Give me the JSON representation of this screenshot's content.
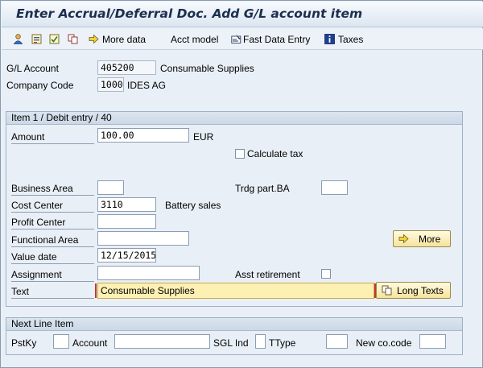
{
  "title": "Enter Accrual/Deferral Doc. Add G/L account item",
  "toolbar": {
    "more_data": "More data",
    "acct_model": "Acct model",
    "fast_data_entry": "Fast Data Entry",
    "taxes": "Taxes"
  },
  "header": {
    "gl_account_label": "G/L Account",
    "gl_account_value": "405200",
    "gl_account_desc": "Consumable Supplies",
    "company_code_label": "Company Code",
    "company_code_value": "1000",
    "company_code_desc": "IDES AG"
  },
  "item": {
    "group_title": "Item 1 / Debit entry / 40",
    "amount_label": "Amount",
    "amount_value": "100.00",
    "currency": "EUR",
    "calculate_tax_label": "Calculate tax",
    "business_area_label": "Business Area",
    "business_area_value": "",
    "trdg_part_label": "Trdg part.BA",
    "trdg_part_value": "",
    "cost_center_label": "Cost Center",
    "cost_center_value": "3110",
    "cost_center_desc": "Battery sales",
    "profit_center_label": "Profit Center",
    "profit_center_value": "",
    "functional_area_label": "Functional Area",
    "functional_area_value": "",
    "more_button": "More",
    "value_date_label": "Value date",
    "value_date_value": "12/15/2015",
    "assignment_label": "Assignment",
    "assignment_value": "",
    "asst_retirement_label": "Asst retirement",
    "text_label": "Text",
    "text_value": "Consumable Supplies",
    "long_texts_button": "Long Texts"
  },
  "next_line": {
    "group_title": "Next Line Item",
    "pstky_label": "PstKy",
    "pstky_value": "",
    "account_label": "Account",
    "account_value": "",
    "sgl_ind_label": "SGL Ind",
    "sgl_ind_value": "",
    "ttype_label": "TType",
    "ttype_value": "",
    "new_co_code_label": "New co.code",
    "new_co_code_value": ""
  },
  "colors": {
    "title_text": "#1c2e4e",
    "background": "#e9eff6",
    "highlight_field": "#fdf0b3",
    "button": "#f6e39a"
  },
  "icons": {
    "toolbar_1": "person-icon",
    "toolbar_2": "document-save-icon",
    "toolbar_3": "document-check-icon",
    "toolbar_4": "copy-icon",
    "more_data": "arrow-right-icon",
    "fast_data_entry": "fast-entry-icon",
    "taxes": "info-icon",
    "more_button": "arrow-right-icon",
    "long_texts_button": "copy-icon"
  }
}
